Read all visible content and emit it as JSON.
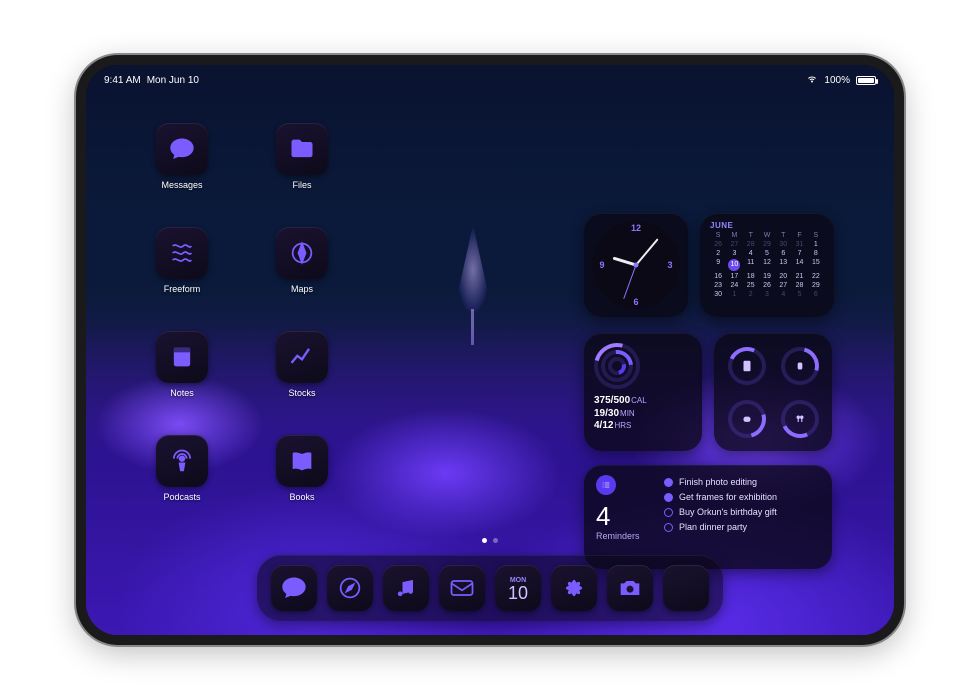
{
  "status": {
    "time": "9:41 AM",
    "date": "Mon Jun 10",
    "battery_pct": "100%"
  },
  "apps": [
    {
      "id": "messages",
      "label": "Messages"
    },
    {
      "id": "files",
      "label": "Files"
    },
    {
      "id": "freeform",
      "label": "Freeform"
    },
    {
      "id": "maps",
      "label": "Maps"
    },
    {
      "id": "notes",
      "label": "Notes"
    },
    {
      "id": "stocks",
      "label": "Stocks"
    },
    {
      "id": "podcasts",
      "label": "Podcasts"
    },
    {
      "id": "books",
      "label": "Books"
    }
  ],
  "clock": {
    "n12": "12",
    "n3": "3",
    "n6": "6",
    "n9": "9"
  },
  "calendar": {
    "month": "JUNE",
    "dow": [
      "S",
      "M",
      "T",
      "W",
      "T",
      "F",
      "S"
    ],
    "weeks": [
      [
        "26",
        "27",
        "28",
        "29",
        "30",
        "31",
        "1"
      ],
      [
        "2",
        "3",
        "4",
        "5",
        "6",
        "7",
        "8"
      ],
      [
        "9",
        "10",
        "11",
        "12",
        "13",
        "14",
        "15"
      ],
      [
        "16",
        "17",
        "18",
        "19",
        "20",
        "21",
        "22"
      ],
      [
        "23",
        "24",
        "25",
        "26",
        "27",
        "28",
        "29"
      ],
      [
        "30",
        "1",
        "2",
        "3",
        "4",
        "5",
        "6"
      ]
    ],
    "today": "10",
    "dim_prefix_count": 6,
    "dim_suffix_count": 6
  },
  "fitness": {
    "cal_value": "375/500",
    "cal_unit": "CAL",
    "min_value": "19/30",
    "min_unit": "MIN",
    "hrs_value": "4/12",
    "hrs_unit": "HRS"
  },
  "batteries": {
    "devices": [
      "ipad",
      "watch",
      "airpods-case",
      "airpods"
    ]
  },
  "reminders": {
    "count": "4",
    "title": "Reminders",
    "items": [
      {
        "text": "Finish photo editing",
        "done": true
      },
      {
        "text": "Get frames for exhibition",
        "done": true
      },
      {
        "text": "Buy Orkun's birthday gift",
        "done": false
      },
      {
        "text": "Plan dinner party",
        "done": false
      }
    ]
  },
  "dock": {
    "cal_dow": "MON",
    "cal_day": "10",
    "items": [
      "messages",
      "safari",
      "music",
      "mail",
      "calendar",
      "photos",
      "camera",
      "app-library"
    ]
  }
}
